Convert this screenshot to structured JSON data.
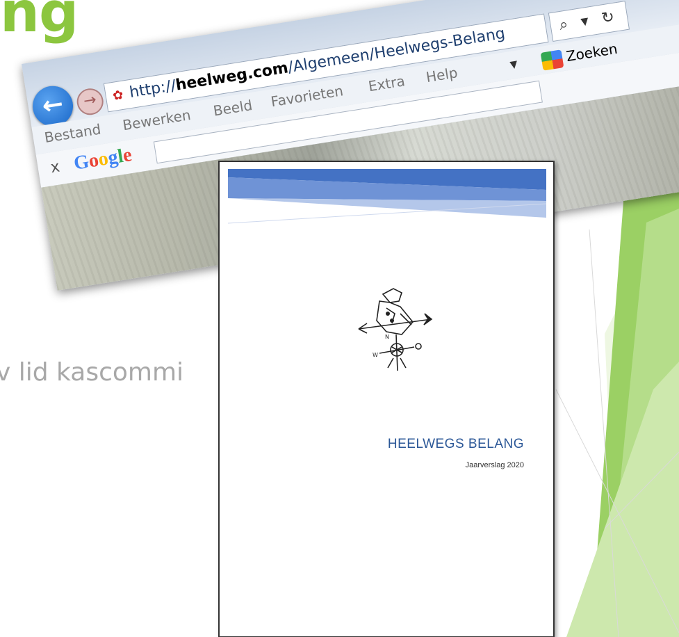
{
  "slide": {
    "title_fragment": "ng",
    "body_fragment": "v lid kascommi",
    "accent_color": "#8cc63f"
  },
  "browser": {
    "url_protocol": "http://",
    "url_domain": "heelweg.com",
    "url_path": "/Algemeen/Heelwegs-Belang",
    "search_tools": "⌕ ▾ ↻",
    "back_icon": "←",
    "forward_icon": "→",
    "menu": [
      "Bestand",
      "Bewerken",
      "Beeld",
      "Favorieten",
      "Extra",
      "Help"
    ],
    "zoeken_label": "Zoeken",
    "google_close": "x",
    "google_logo_letters": [
      "G",
      "o",
      "o",
      "g",
      "l",
      "e"
    ]
  },
  "document": {
    "title": "HEELWEGS BELANG",
    "subtitle": "Jaarverslag 2020",
    "title_color": "#2b5797",
    "banner_color": "#4472c4"
  }
}
